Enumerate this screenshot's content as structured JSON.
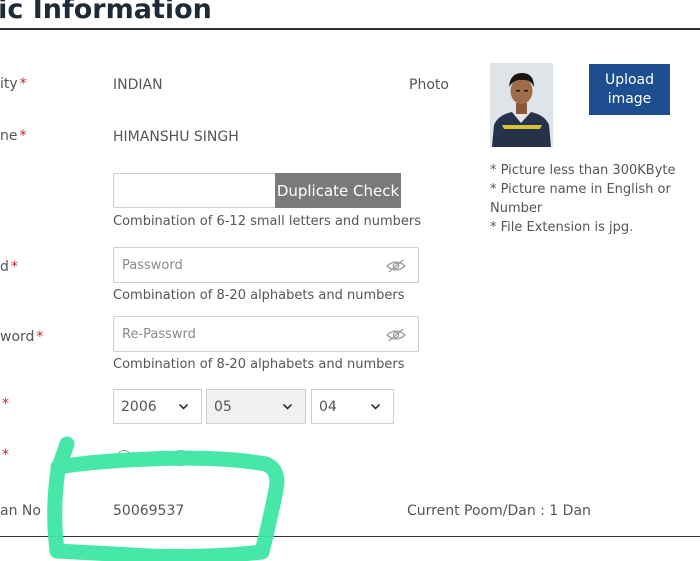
{
  "section": {
    "title": "sic Information"
  },
  "fields": {
    "nationality": {
      "label": "ity",
      "required": "*",
      "value": "INDIAN"
    },
    "name": {
      "label": "ne",
      "required": "*",
      "value": "HIMANSHU SINGH"
    },
    "user_id": {
      "value": "",
      "button": "Duplicate Check",
      "hint": "Combination of 6-12 small letters and numbers"
    },
    "password": {
      "label": "d",
      "required": "*",
      "placeholder": "Password",
      "hint": "Combination of 8-20 alphabets and numbers"
    },
    "re_password": {
      "label": "word",
      "required": "*",
      "placeholder": "Re-Passwrd",
      "hint": "Combination of 8-20 alphabets and numbers"
    },
    "birth_date": {
      "label": "",
      "required": "*",
      "year": "2006",
      "month": "05",
      "day": "04"
    },
    "gender": {
      "label": "",
      "required": "*"
    },
    "dan_no": {
      "label": "an No",
      "value": "50069537"
    },
    "current_poom_dan": {
      "text": "Current Poom/Dan : 1 Dan"
    }
  },
  "photo": {
    "label": "Photo",
    "upload_button": "Upload image",
    "notes": [
      "* Picture less than 300KByte",
      "* Picture name in English or",
      "Number",
      "* File Extension is jpg."
    ]
  },
  "colors": {
    "required": "#c0272d",
    "upload_button": "#1d4e8f",
    "duplicate_button": "#7a7a7a",
    "highlight_scribble": "#3de6a4"
  }
}
